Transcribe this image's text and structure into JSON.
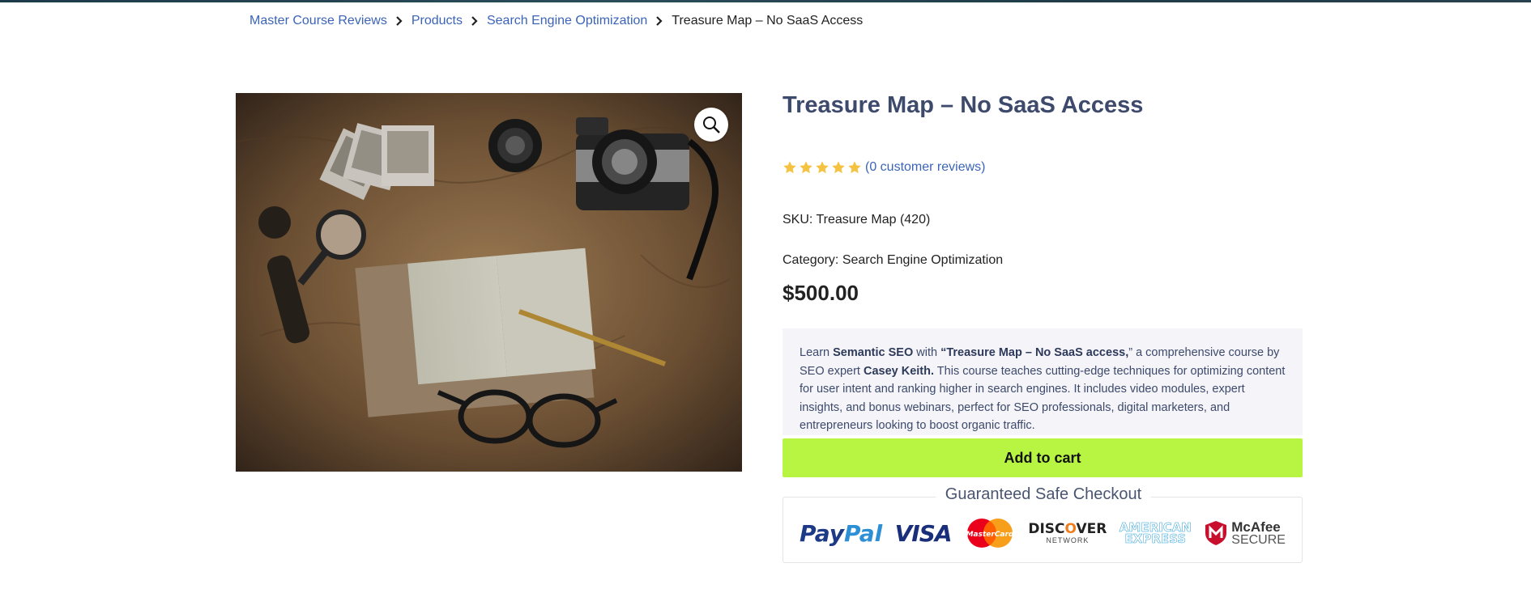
{
  "breadcrumb": {
    "items": [
      "Master Course Reviews",
      "Products",
      "Search Engine Optimization"
    ],
    "current": "Treasure Map – No SaaS Access"
  },
  "product": {
    "title": "Treasure Map – No SaaS Access",
    "rating_value": 5,
    "rating_max": 5,
    "reviews_link": "(0 customer reviews)",
    "sku_label": "SKU:",
    "sku_value": "Treasure Map (420)",
    "category_label": "Category:",
    "category_value": "Search Engine Optimization",
    "price": "$500.00",
    "description": {
      "p1": "Learn ",
      "b1": "Semantic SEO",
      "p2": " with ",
      "b2": "“Treasure Map – No SaaS access,",
      "p3": "” a comprehensive course by SEO expert ",
      "b3": "Casey Keith.",
      "p4": " This course teaches cutting-edge techniques for optimizing content for user intent and ranking higher in search engines. It includes video modules, expert insights, and bonus webinars, perfect for SEO professionals, digital marketers, and entrepreneurs looking to boost organic traffic."
    },
    "add_to_cart": "Add to cart"
  },
  "checkout": {
    "title": "Guaranteed Safe Checkout",
    "logos": {
      "paypal_1": "Pay",
      "paypal_2": "Pal",
      "visa": "VISA",
      "mastercard": "MasterCard",
      "discover_1": "DISC",
      "discover_o": "O",
      "discover_2": "VER",
      "discover_sub": "NETWORK",
      "amex_1": "AMERICAN",
      "amex_2": "EXPRESS",
      "mcafee_1": "McAfee",
      "mcafee_2": "SECURE"
    }
  },
  "colors": {
    "link": "#3b64b8",
    "title": "#3d4a6b",
    "star": "#f5c242",
    "cart_button": "#b7f542",
    "description_bg": "#f4f4f9"
  },
  "icons": [
    "chevron-right-icon",
    "magnifier-icon",
    "star-icon"
  ]
}
